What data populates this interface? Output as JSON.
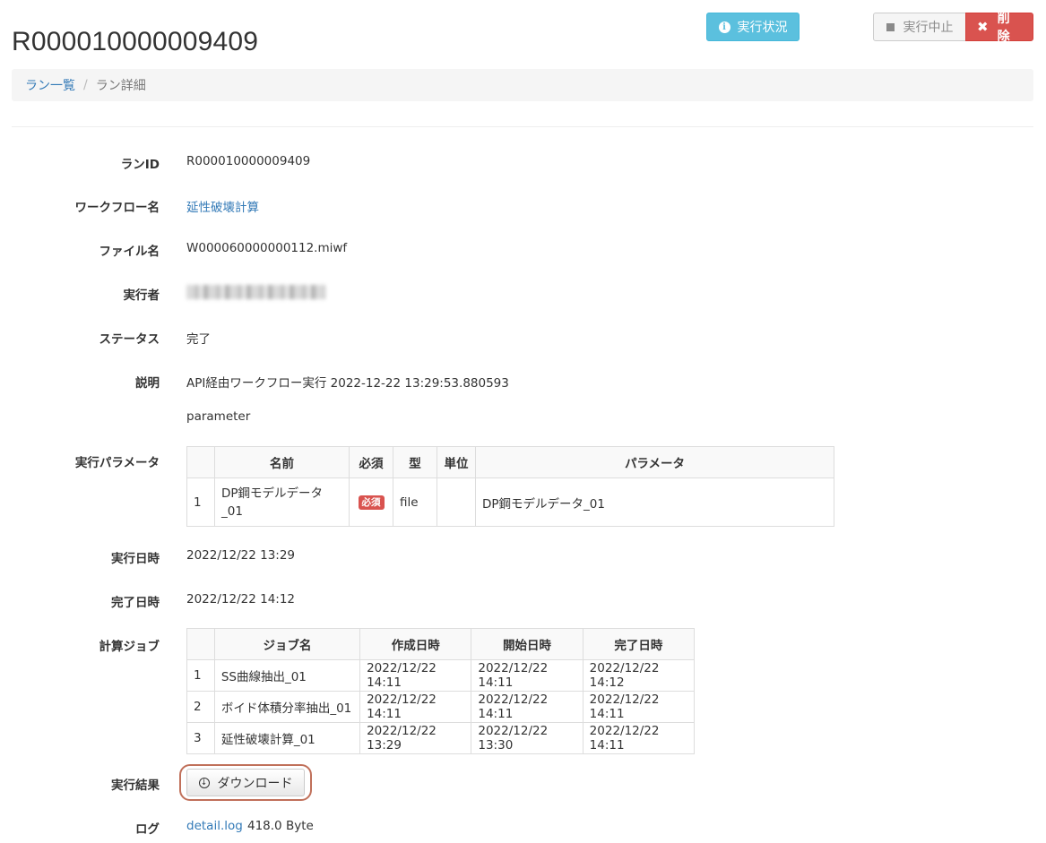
{
  "header": {
    "title": "R000010000009409",
    "status_button": "実行状況",
    "stop_button": "実行中止",
    "delete_button": "削除"
  },
  "breadcrumb": {
    "items": [
      "ラン一覧",
      "ラン詳細"
    ],
    "separator": "/"
  },
  "details": {
    "run_id_label": "ランID",
    "run_id": "R000010000009409",
    "workflow_label": "ワークフロー名",
    "workflow": "延性破壊計算",
    "file_label": "ファイル名",
    "file": "W000060000000112.miwf",
    "executor_label": "実行者",
    "status_label": "ステータス",
    "status": "完了",
    "description_label": "説明",
    "description": "API経由ワークフロー実行 2022-12-22 13:29:53.880593",
    "description_extra": "parameter",
    "params_label": "実行パラメータ",
    "start_label": "実行日時",
    "start": "2022/12/22 13:29",
    "end_label": "完了日時",
    "end": "2022/12/22 14:12",
    "jobs_label": "計算ジョブ",
    "result_label": "実行結果",
    "download_button": "ダウンロード",
    "log_label": "ログ",
    "log_link": "detail.log",
    "log_size": "418.0 Byte"
  },
  "params_table": {
    "headers": [
      "",
      "名前",
      "必須",
      "型",
      "単位",
      "パラメータ"
    ],
    "rows": [
      {
        "no": "1",
        "name": "DP鋼モデルデータ_01",
        "required": "必須",
        "type": "file",
        "unit": "",
        "param": "DP鋼モデルデータ_01"
      }
    ]
  },
  "jobs_table": {
    "headers": [
      "",
      "ジョブ名",
      "作成日時",
      "開始日時",
      "完了日時"
    ],
    "rows": [
      {
        "no": "1",
        "name": "SS曲線抽出_01",
        "created": "2022/12/22 14:11",
        "started": "2022/12/22 14:11",
        "finished": "2022/12/22 14:12"
      },
      {
        "no": "2",
        "name": "ボイド体積分率抽出_01",
        "created": "2022/12/22 14:11",
        "started": "2022/12/22 14:11",
        "finished": "2022/12/22 14:11"
      },
      {
        "no": "3",
        "name": "延性破壊計算_01",
        "created": "2022/12/22 13:29",
        "started": "2022/12/22 13:30",
        "finished": "2022/12/22 14:11"
      }
    ]
  },
  "icons": {
    "status": "info-circle-icon",
    "stop": "stop-square-icon",
    "delete": "close-x-icon",
    "download": "download-circle-icon"
  },
  "colors": {
    "info": "#5bc0de",
    "danger": "#d9534f",
    "link": "#337ab7",
    "highlight_outline": "#c0705a"
  }
}
